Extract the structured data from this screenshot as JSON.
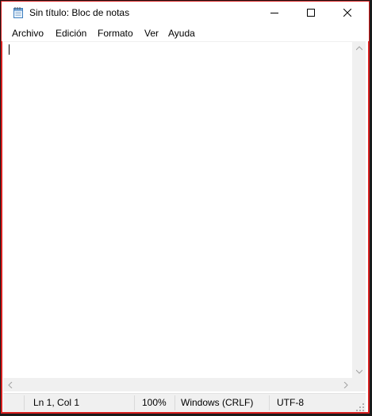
{
  "window": {
    "title": "Sin título: Bloc de notas",
    "app_icon": "notepad-icon"
  },
  "caption_buttons": {
    "minimize_icon": "minimize-icon",
    "maximize_icon": "maximize-icon",
    "close_icon": "close-icon"
  },
  "menu": {
    "items": [
      {
        "label": "Archivo"
      },
      {
        "label": "Edición"
      },
      {
        "label": "Formato"
      },
      {
        "label": "Ver"
      },
      {
        "label": "Ayuda"
      }
    ]
  },
  "editor": {
    "content": ""
  },
  "statusbar": {
    "position": "Ln 1, Col 1",
    "zoom": "100%",
    "line_ending": "Windows (CRLF)",
    "encoding": "UTF-8"
  },
  "colors": {
    "frame_border": "#d81f1f",
    "chrome": "#f0f0f0",
    "background": "#ffffff"
  }
}
